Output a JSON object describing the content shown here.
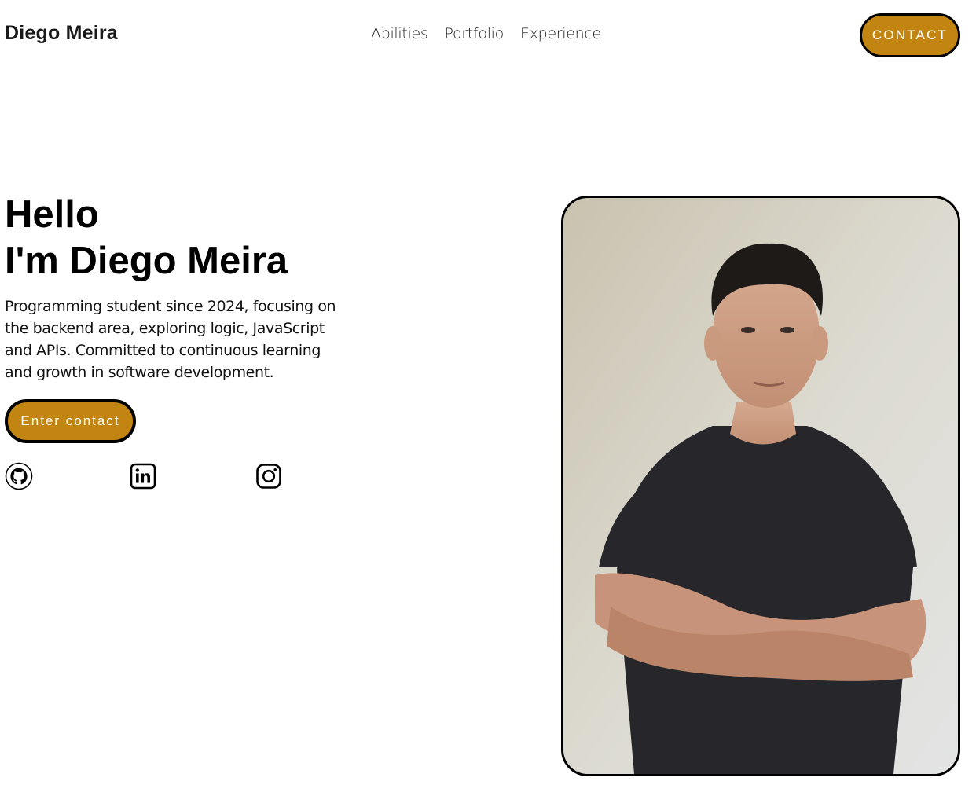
{
  "header": {
    "brand": "Diego Meira",
    "nav": [
      {
        "label": "Abilities"
      },
      {
        "label": "Portfolio"
      },
      {
        "label": "Experience"
      }
    ],
    "contact_label": "CONTACT"
  },
  "hero": {
    "title_line1": "Hello",
    "title_line2": "I'm Diego Meira",
    "description": "Programming student since 2024, focusing on the backend area, exploring logic, JavaScript and APIs. Committed to continuous learning and growth in software development.",
    "cta_label": "Enter contact",
    "socials": [
      {
        "icon": "github-icon"
      },
      {
        "icon": "linkedin-icon"
      },
      {
        "icon": "instagram-icon"
      }
    ]
  },
  "colors": {
    "accent": "#c38512",
    "text": "#000000",
    "background": "#ffffff",
    "border": "#000000"
  }
}
